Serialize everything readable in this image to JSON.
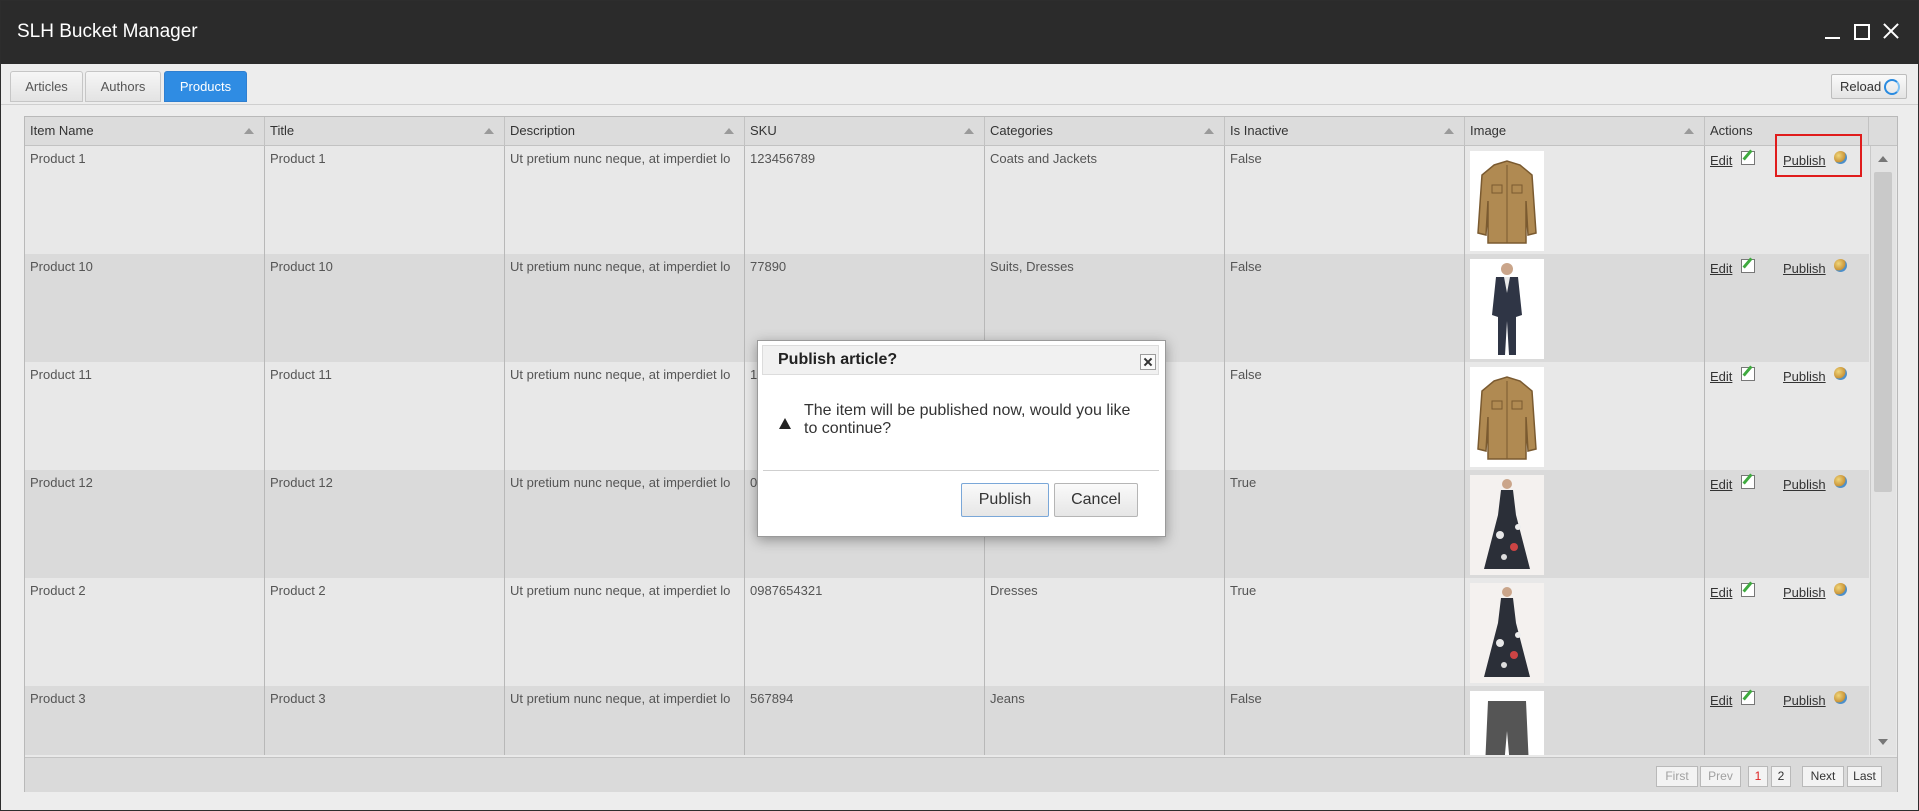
{
  "window": {
    "title": "SLH Bucket Manager"
  },
  "tabs": [
    {
      "label": "Articles"
    },
    {
      "label": "Authors"
    },
    {
      "label": "Products"
    }
  ],
  "toolbar": {
    "reload_label": "Reload"
  },
  "grid": {
    "columns": [
      "Item Name",
      "Title",
      "Description",
      "SKU",
      "Categories",
      "Is Inactive",
      "Image",
      "Actions"
    ],
    "rows": [
      {
        "item_name": "Product 1",
        "title": "Product 1",
        "description": "Ut pretium nunc neque, at imperdiet lo",
        "sku": "123456789",
        "categories": "Coats and Jackets",
        "inactive": "False",
        "image": "jacket"
      },
      {
        "item_name": "Product 10",
        "title": "Product 10",
        "description": "Ut pretium nunc neque, at imperdiet lo",
        "sku": "77890",
        "categories": "Suits, Dresses",
        "inactive": "False",
        "image": "suit"
      },
      {
        "item_name": "Product 11",
        "title": "Product 11",
        "description": "Ut pretium nunc neque, at imperdiet lo",
        "sku": "1",
        "categories": "",
        "inactive": "False",
        "image": "jacket"
      },
      {
        "item_name": "Product 12",
        "title": "Product 12",
        "description": "Ut pretium nunc neque, at imperdiet lo",
        "sku": "0",
        "categories": "",
        "inactive": "True",
        "image": "dress"
      },
      {
        "item_name": "Product 2",
        "title": "Product 2",
        "description": "Ut pretium nunc neque, at imperdiet lo",
        "sku": "0987654321",
        "categories": "Dresses",
        "inactive": "True",
        "image": "dress"
      },
      {
        "item_name": "Product 3",
        "title": "Product 3",
        "description": "Ut pretium nunc neque, at imperdiet lo",
        "sku": "567894",
        "categories": "Jeans",
        "inactive": "False",
        "image": "pants"
      }
    ],
    "actions": {
      "edit_label": "Edit",
      "publish_label": "Publish"
    }
  },
  "pager": {
    "first": "First",
    "prev": "Prev",
    "pages": [
      "1",
      "2"
    ],
    "current_page": "1",
    "next": "Next",
    "last": "Last"
  },
  "dialog": {
    "title": "Publish article?",
    "message": "The item will be published now, would you like to continue?",
    "publish_label": "Publish",
    "cancel_label": "Cancel"
  },
  "colors": {
    "active_tab": "#2f8ce3",
    "titlebar": "#2b2b2b",
    "highlight": "#e01c1c"
  }
}
